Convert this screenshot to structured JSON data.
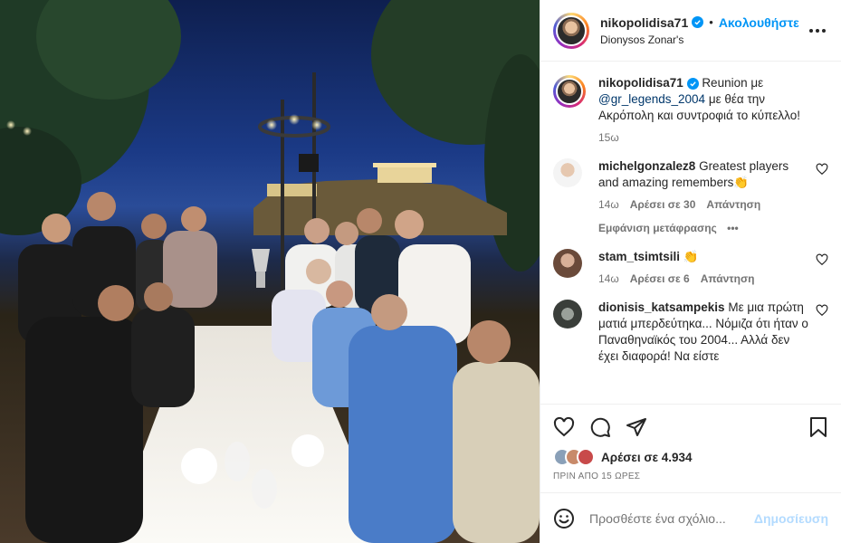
{
  "post": {
    "author": "nikopolidisa71",
    "follow_label": "Ακολουθήστε",
    "location": "Dionysos Zonar's",
    "caption_prefix": "Reunion με",
    "caption_mention": "@gr_legends_2004",
    "caption_rest": "με θέα την Ακρόπολη και συντροφιά το κύπελλο!",
    "caption_time": "15ω"
  },
  "comments": [
    {
      "user": "michelgonzalez8",
      "text": "Greatest players and amazing remembers👏",
      "time": "14ω",
      "likes": "Αρέσει σε 30",
      "reply": "Απάντηση",
      "translation": "Εμφάνιση μετάφρασης",
      "more": "•••"
    },
    {
      "user": "stam_tsimtsili",
      "text": "👏",
      "time": "14ω",
      "likes": "Αρέσει σε 6",
      "reply": "Απάντηση"
    },
    {
      "user": "dionisis_katsampekis",
      "text": "Με μια πρώτη ματιά μπερδεύτηκα... Νόμιζα ότι ήταν ο Παναθηναϊκός του 2004... Αλλά δεν έχει διαφορά! Να είστε"
    }
  ],
  "engagement": {
    "likes_label": "Αρέσει σε 4.934",
    "date": "ΠΡΙΝ ΑΠΟ 15 ΩΡΕΣ"
  },
  "composer": {
    "placeholder": "Προσθέστε ένα σχόλιο...",
    "post_label": "Δημοσίευση"
  },
  "icons": [
    "verified-badge-icon",
    "more-options-icon",
    "heart-icon",
    "comment-icon",
    "share-icon",
    "bookmark-icon",
    "emoji-icon"
  ],
  "colors": {
    "accent": "#0095f6",
    "post_disabled": "#b3dbff",
    "muted": "#737373"
  }
}
